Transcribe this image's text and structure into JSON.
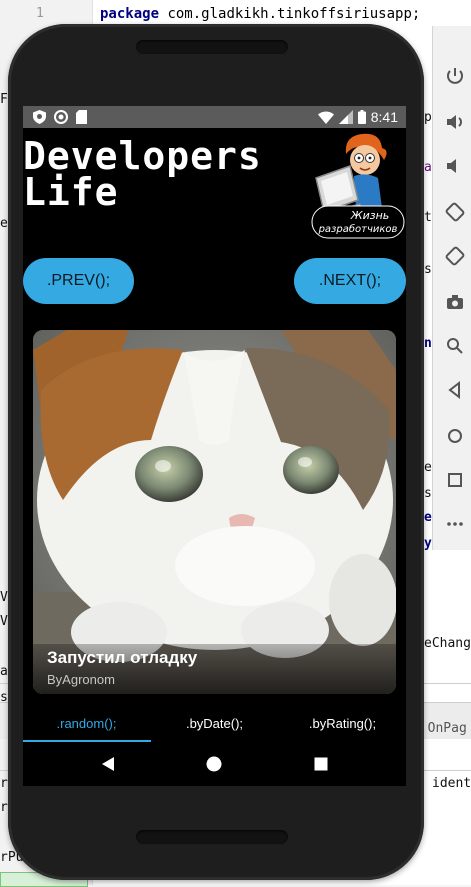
{
  "ide": {
    "line_number": "1",
    "code_keyword": "package",
    "code_rest": " com.gladkikh.tinkoffsiriusapp;",
    "fragments": {
      "f1": "Fr",
      "f2": "ew",
      "f3": "p",
      "f4": "a",
      "f5": "t",
      "f6": "s",
      "f7": "n",
      "f8": "e",
      "f9": "s",
      "f10": "e",
      "f11": "y",
      "f12": "eChang",
      "f13": "V",
      "f14": "V",
      "f15": "a",
      "f16": "s",
      "f17": "w OnPag",
      "f18": "ident",
      "f19": "r",
      "f20": "r",
      "f21": "rPu"
    }
  },
  "status_bar": {
    "time": "8:41",
    "icons": [
      "shield-icon",
      "circle-icon",
      "sdcard-icon",
      "wifi-icon",
      "signal-icon",
      "battery-icon"
    ]
  },
  "app": {
    "title": "Developers\nLife",
    "logo_text_line1": "Жизнь",
    "logo_text_line2": "разработчиков",
    "prev_label": ".PREV();",
    "next_label": ".NEXT();",
    "post": {
      "title": "Запустил отладку",
      "author": "ByAgronom"
    },
    "tabs": [
      {
        "label": ".random();",
        "active": true
      },
      {
        "label": ".byDate();",
        "active": false
      },
      {
        "label": ".byRating();",
        "active": false
      }
    ]
  },
  "colors": {
    "accent": "#35a9e2",
    "status_bar": "#5b5b5b",
    "screen_background": "#000000"
  },
  "emulator_toolbar": {
    "icons": [
      "power-icon",
      "volume-up-icon",
      "volume-down-icon",
      "rotate-left-icon",
      "rotate-right-icon",
      "camera-icon",
      "zoom-icon",
      "back-icon",
      "home-icon",
      "overview-icon",
      "more-icon"
    ]
  }
}
